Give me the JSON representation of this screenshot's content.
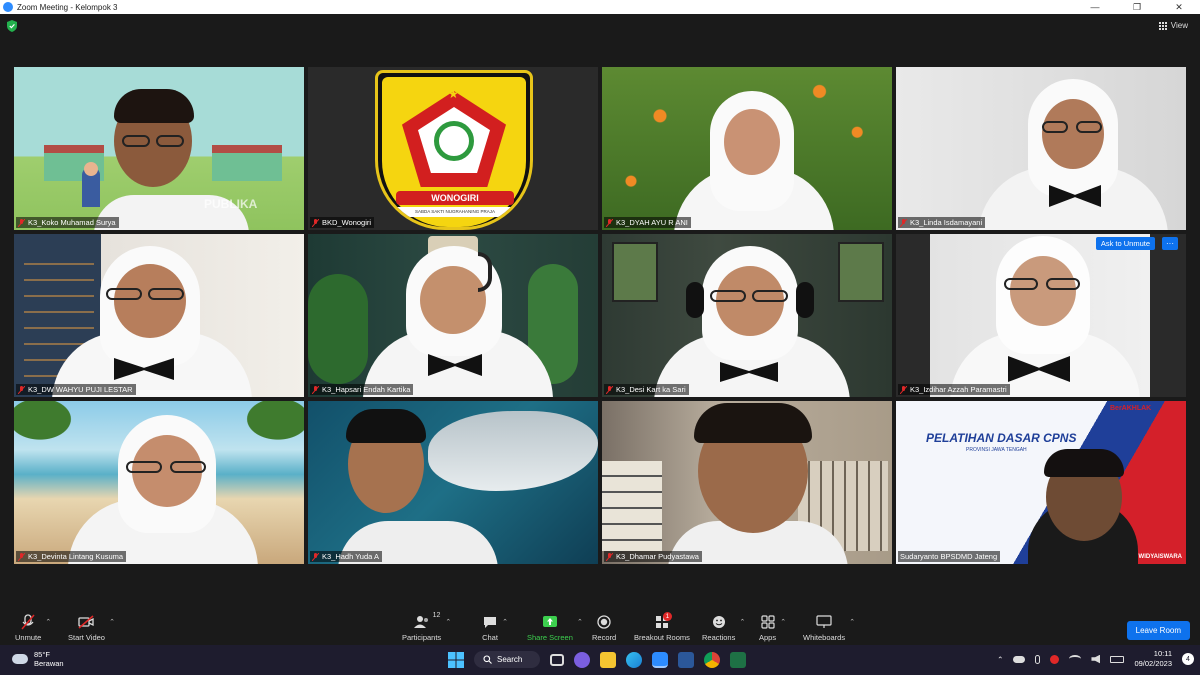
{
  "window": {
    "title": "Zoom Meeting - Kelompok 3",
    "controls": [
      "—",
      "❐",
      "✕"
    ]
  },
  "meeting": {
    "view_label": "View",
    "ask_to_unmute_label": "Ask to Unmute",
    "more_label": "···",
    "participants": [
      {
        "name": "K3_Koko Muhamad Surya"
      },
      {
        "name": "BKD_Wonogiri"
      },
      {
        "name": "K3_DYAH AYU R ANI"
      },
      {
        "name": "K3_Linda Isdamayani"
      },
      {
        "name": "K3_DW  WAHYU PUJI LESTAR"
      },
      {
        "name": "K3_Hapsari Endah Kartika"
      },
      {
        "name": "K3_Desi Kart ka Sari"
      },
      {
        "name": "K3_Izdihar Azzah Paramastri"
      },
      {
        "name": "K3_Devinta Lintang Kusuma"
      },
      {
        "name": "K3_Hadh  Yuda A"
      },
      {
        "name": "K3_Dhamar Pudyastawa"
      },
      {
        "name": "Sudaryanto BPSDMD Jateng"
      }
    ],
    "tiles_text": {
      "watermark": "PUBLIKA",
      "logo_text": "WONOGIRI",
      "logo_motto": "SABDA SAKTI NUGRAHANING PRAJA",
      "banner_title": "PELATIHAN DASAR CPNS",
      "banner_sub": "PROVINSI JAWA TENGAH",
      "banner_brand": "BerAKHLAK",
      "banner_footer": "WIDYAISWARA"
    }
  },
  "toolbar": {
    "unmute": "Unmute",
    "start_video": "Start Video",
    "participants": "Participants",
    "participants_count": "12",
    "chat": "Chat",
    "share_screen": "Share Screen",
    "record": "Record",
    "breakout_rooms": "Breakout Rooms",
    "breakout_badge": "1",
    "reactions": "Reactions",
    "apps": "Apps",
    "whiteboards": "Whiteboards",
    "leave": "Leave Room"
  },
  "taskbar": {
    "temperature": "85°F",
    "weather": "Berawan",
    "search_label": "Search",
    "time": "10:11",
    "date": "09/02/2023",
    "notifications": "4"
  },
  "colors": {
    "accent": "#0e72ed",
    "active_speaker": "#e4e600",
    "share_green": "#3ccf4e",
    "muted_red": "#e02828"
  }
}
